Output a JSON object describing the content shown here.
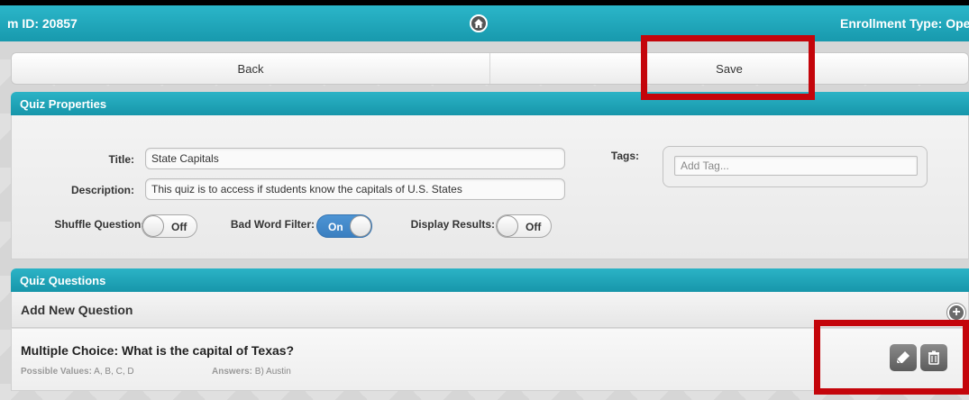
{
  "header": {
    "left_text": "m ID: 20857",
    "right_text": "Enrollment Type: Oper",
    "home_icon": "home-icon"
  },
  "nav": {
    "back_label": "Back",
    "save_label": "Save"
  },
  "properties": {
    "section_title": "Quiz Properties",
    "title_label": "Title:",
    "title_value": "State Capitals",
    "description_label": "Description:",
    "description_value": "This quiz is to access if students know the capitals of U.S. States",
    "tags_label": "Tags:",
    "tags_placeholder": "Add Tag...",
    "shuffle_label": "Shuffle Questions:",
    "shuffle_state": "Off",
    "badword_label": "Bad Word Filter:",
    "badword_state": "On",
    "display_label": "Display Results:",
    "display_state": "Off"
  },
  "questions": {
    "section_title": "Quiz Questions",
    "add_label": "Add New Question",
    "items": [
      {
        "title": "Multiple Choice: What is the capital of Texas?",
        "possible_label": "Possible Values:",
        "possible_value": "A, B, C, D",
        "answers_label": "Answers:",
        "answers_value": "B) Austin"
      }
    ]
  },
  "colors": {
    "header": "#1fa7bb",
    "highlight": "#c4050b",
    "toggle_on": "#3a7fc0"
  }
}
